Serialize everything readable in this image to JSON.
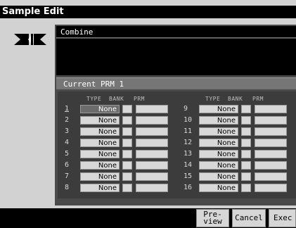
{
  "window": {
    "title": "Sample Edit"
  },
  "combine": {
    "label": "Combine"
  },
  "current": {
    "label": "Current PRM 1"
  },
  "columns": {
    "type": "TYPE",
    "bank": "BANK",
    "prm": "PRM"
  },
  "rows": [
    {
      "num": "1",
      "type": "None",
      "selected": true
    },
    {
      "num": "2",
      "type": "None"
    },
    {
      "num": "3",
      "type": "None"
    },
    {
      "num": "4",
      "type": "None"
    },
    {
      "num": "5",
      "type": "None"
    },
    {
      "num": "6",
      "type": "None"
    },
    {
      "num": "7",
      "type": "None"
    },
    {
      "num": "8",
      "type": "None"
    },
    {
      "num": "9",
      "type": "None"
    },
    {
      "num": "10",
      "type": "None"
    },
    {
      "num": "11",
      "type": "None"
    },
    {
      "num": "12",
      "type": "None"
    },
    {
      "num": "13",
      "type": "None"
    },
    {
      "num": "14",
      "type": "None"
    },
    {
      "num": "15",
      "type": "None"
    },
    {
      "num": "16",
      "type": "None"
    }
  ],
  "footer": {
    "preview_line1": "Pre-",
    "preview_line2": "view",
    "cancel": "Cancel",
    "exec": "Exec"
  },
  "icons": {
    "logo": "sample-edit-logo-icon"
  }
}
